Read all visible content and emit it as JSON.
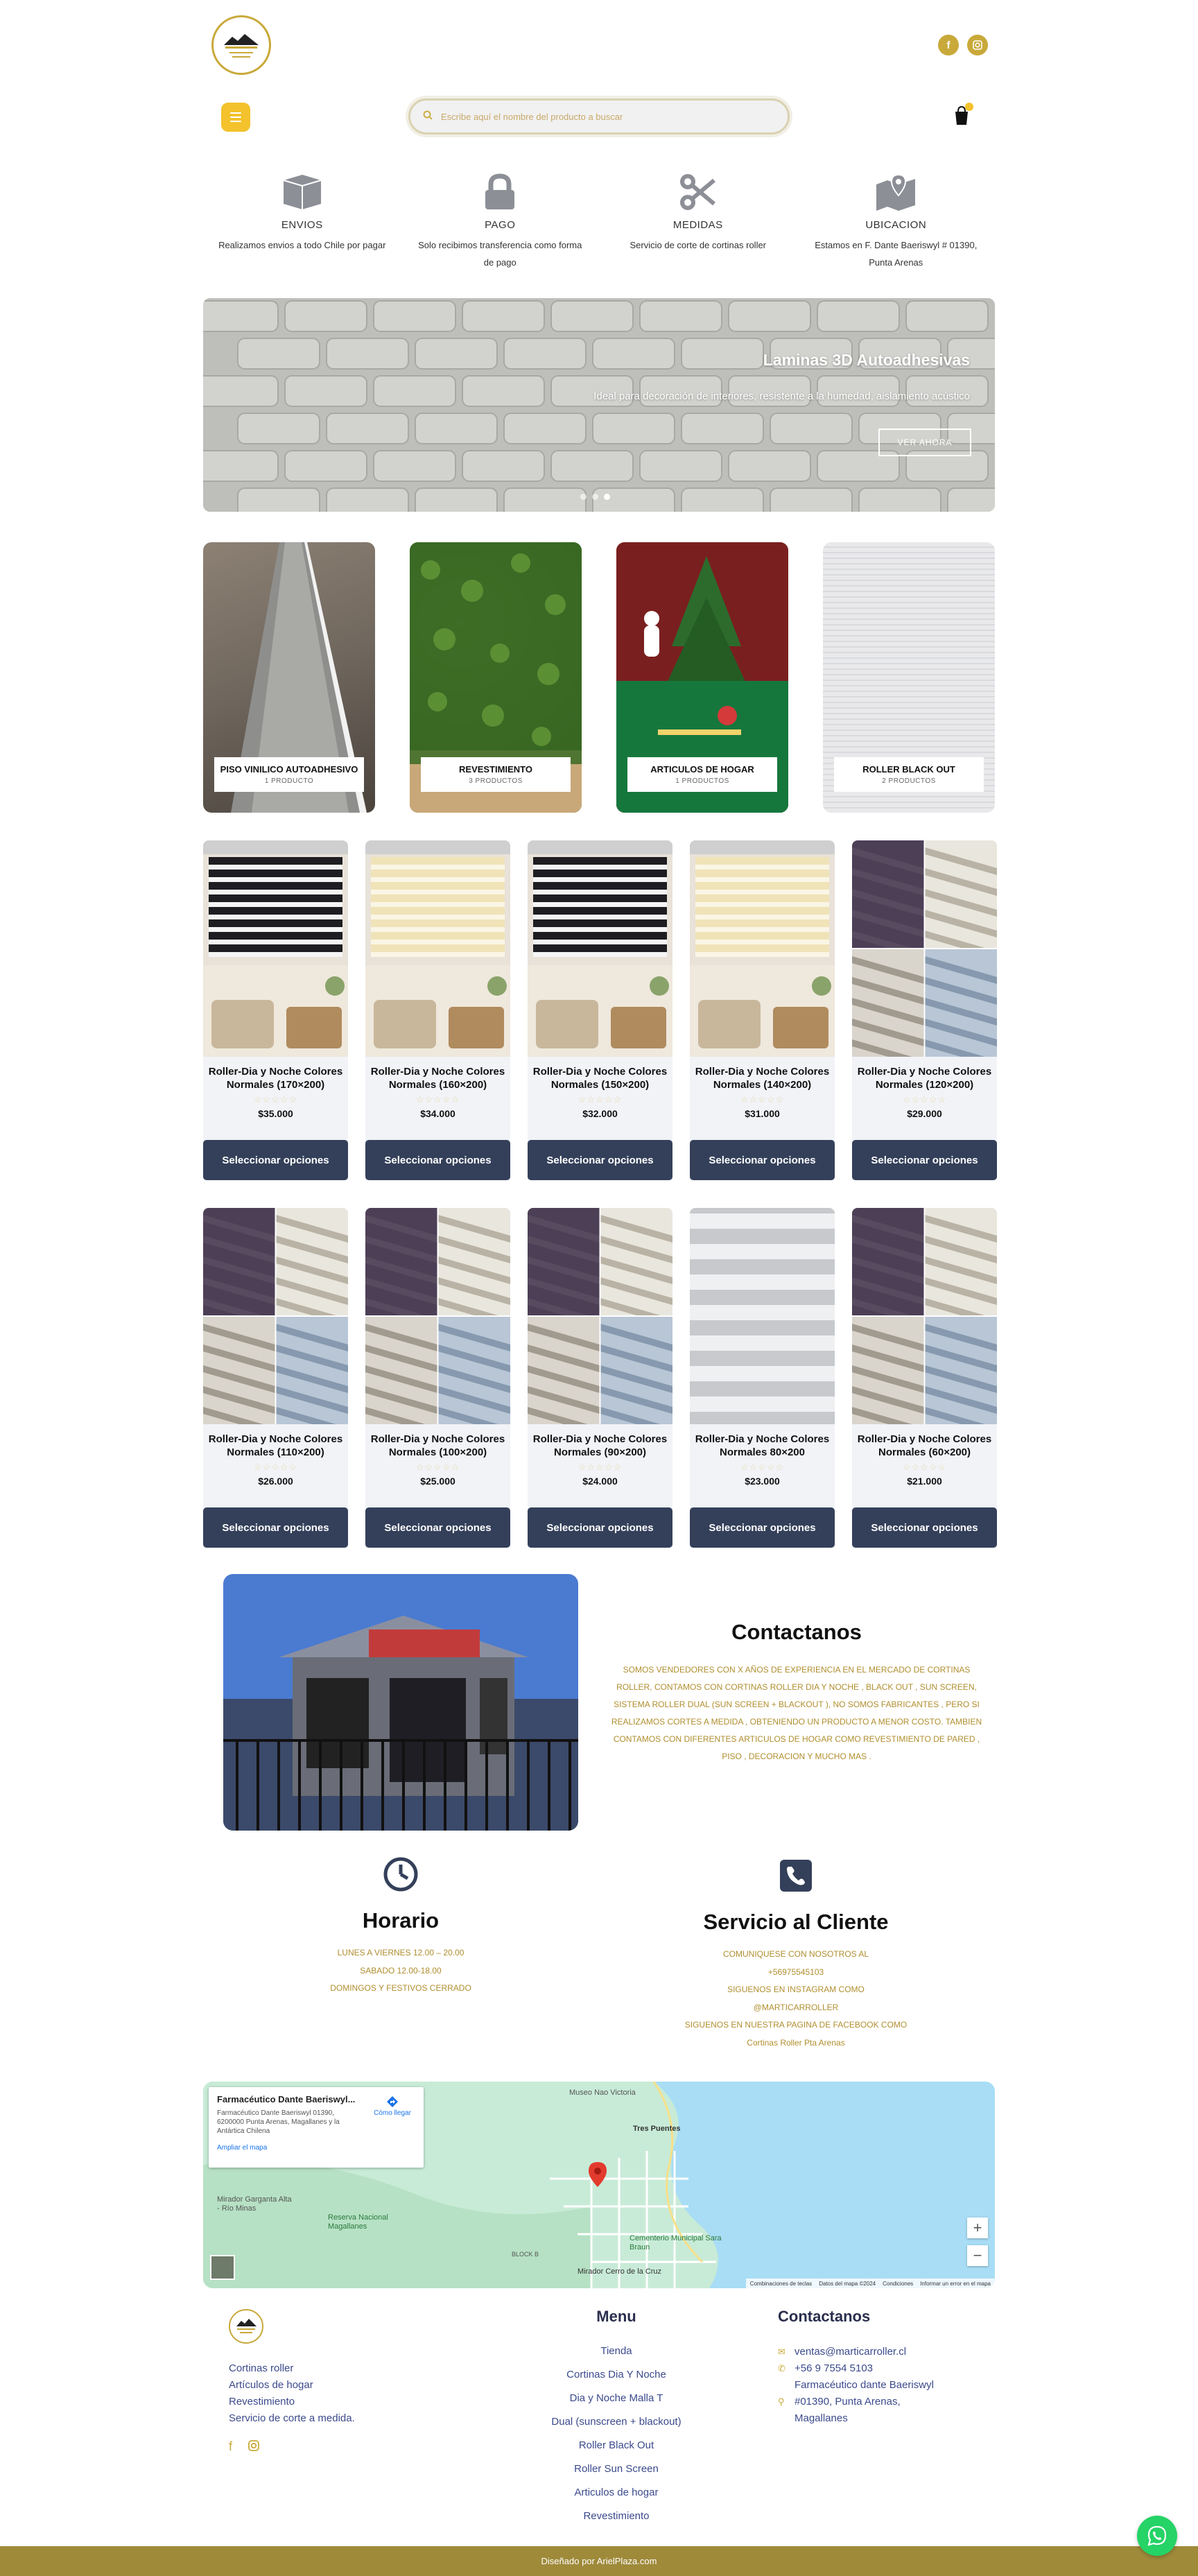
{
  "header": {
    "search_placeholder": "Escribe aquí el nombre del producto a buscar",
    "cart_count": "0",
    "social": [
      "facebook-icon",
      "instagram-icon"
    ]
  },
  "features": [
    {
      "icon": "box-icon",
      "title": "ENVIOS",
      "text": "Realizamos envios a todo Chile por pagar"
    },
    {
      "icon": "lock-icon",
      "title": "PAGO",
      "text": "Solo recibimos transferencia como forma de pago"
    },
    {
      "icon": "scissors-icon",
      "title": "MEDIDAS",
      "text": "Servicio de corte de cortinas roller"
    },
    {
      "icon": "map-pin-icon",
      "title": "UBICACION",
      "text": "Estamos en F. Dante Baeriswyl # 01390, Punta Arenas"
    }
  ],
  "hero": {
    "title": "Laminas 3D Autoadhesivas",
    "subtitle": "Ideal para decoración de interiores, resistente a la humedad, aislamiento acústico",
    "button": "VER AHORA"
  },
  "categories": [
    {
      "name": "PISO VINILICO AUTOADHESIVO",
      "count": "1 PRODUCTO"
    },
    {
      "name": "REVESTIMIENTO",
      "count": "3 PRODUCTOS"
    },
    {
      "name": "ARTICULOS DE HOGAR",
      "count": "1 PRODUCTOS"
    },
    {
      "name": "ROLLER BLACK OUT",
      "count": "2 PRODUCTOS"
    }
  ],
  "products_row1": [
    {
      "title": "Roller-Dia y Noche Colores Normales (170×200)",
      "price": "$35.000",
      "button": "Seleccionar opciones",
      "img": "dark"
    },
    {
      "title": "Roller-Dia y Noche Colores Normales (160×200)",
      "price": "$34.000",
      "button": "Seleccionar opciones",
      "img": "cream"
    },
    {
      "title": "Roller-Dia y Noche Colores Normales (150×200)",
      "price": "$32.000",
      "button": "Seleccionar opciones",
      "img": "dark"
    },
    {
      "title": "Roller-Dia y Noche Colores Normales (140×200)",
      "price": "$31.000",
      "button": "Seleccionar opciones",
      "img": "cream"
    },
    {
      "title": "Roller-Dia y Noche Colores Normales (120×200)",
      "price": "$29.000",
      "button": "Seleccionar opciones",
      "img": "grid"
    }
  ],
  "products_row2": [
    {
      "title": "Roller-Dia y Noche Colores Normales (110×200)",
      "price": "$26.000",
      "button": "Seleccionar opciones",
      "img": "grid"
    },
    {
      "title": "Roller-Dia y Noche Colores Normales (100×200)",
      "price": "$25.000",
      "button": "Seleccionar opciones",
      "img": "grid"
    },
    {
      "title": "Roller-Dia y Noche Colores Normales (90×200)",
      "price": "$24.000",
      "button": "Seleccionar opciones",
      "img": "grid"
    },
    {
      "title": "Roller-Dia y Noche Colores Normales 80×200",
      "price": "$23.000",
      "button": "Seleccionar opciones",
      "img": "white"
    },
    {
      "title": "Roller-Dia y Noche Colores Normales (60×200)",
      "price": "$21.000",
      "button": "Seleccionar opciones",
      "img": "grid"
    }
  ],
  "about": {
    "title": "Contactanos",
    "text": "SOMOS VENDEDORES CON X AÑOS DE EXPERIENCIA EN EL MERCADO DE CORTINAS ROLLER, CONTAMOS CON CORTINAS ROLLER DIA Y NOCHE , BLACK OUT , SUN SCREEN, SISTEMA ROLLER DUAL (SUN SCREEN + BLACKOUT ), NO SOMOS FABRICANTES , PERO SI REALIZAMOS CORTES A MEDIDA , OBTENIENDO UN PRODUCTO A MENOR COSTO. TAMBIEN CONTAMOS CON DIFERENTES ARTICULOS DE HOGAR COMO REVESTIMIENTO DE PARED , PISO , DECORACION Y MUCHO MAS ."
  },
  "horario": {
    "title": "Horario",
    "lines": [
      "LUNES A VIERNES 12.00 – 20.00",
      "SABADO 12.00-18.00",
      "DOMINGOS Y FESTIVOS CERRADO"
    ]
  },
  "servicio": {
    "title": "Servicio al Cliente",
    "lines": [
      "COMUNIQUESE CON NOSOTROS AL",
      "+56975545103",
      "SIGUENOS EN INSTAGRAM COMO",
      "@MARTICARROLLER",
      "SIGUENOS EN NUESTRA PAGINA DE FACEBOOK COMO",
      "Cortinas Roller Pta Arenas"
    ]
  },
  "map": {
    "place": "Farmacéutico Dante Baeriswyl...",
    "address": "Farmacéutico Dante Baeriswyl 01390, 6200000 Punta Arenas, Magallanes y la Antártica Chilena",
    "directions": "Cómo llegar",
    "enlarge": "Ampliar el mapa",
    "labels": [
      "Museo Nao Victoria",
      "Tres Puentes",
      "Mirador Garganta Alta - Río Minas",
      "Reserva Nacional Magallanes",
      "Cementerio Municipal Sara Braun",
      "Mirador Cerro de la Cruz",
      "BLOCK B"
    ],
    "footer": [
      "Combinaciones de teclas",
      "Datos del mapa ©2024",
      "Condiciones",
      "Informar un error en el mapa"
    ]
  },
  "footer": {
    "links": [
      "Cortinas roller",
      "Artículos de hogar",
      "Revestimiento",
      "Servicio de corte a medida."
    ],
    "menu_title": "Menu",
    "menu": [
      "Tienda",
      "Cortinas Dia Y Noche",
      "Dia y Noche Malla T",
      "Dual (sunscreen + blackout)",
      "Roller Black Out",
      "Roller Sun Screen",
      "Articulos de hogar",
      "Revestimiento"
    ],
    "contact_title": "Contactanos",
    "email": "ventas@marticarroller.cl",
    "phone": "+56 9 7554 5103",
    "address1": "Farmacéutico dante Baeriswyl",
    "address2": "#01390, Punta Arenas, Magallanes",
    "credit": "Diseñado por ArielPlaza.com"
  },
  "colors": {
    "gold": "#c9a93a",
    "navy": "#34405a",
    "footer_bar": "#9f8a3a"
  }
}
